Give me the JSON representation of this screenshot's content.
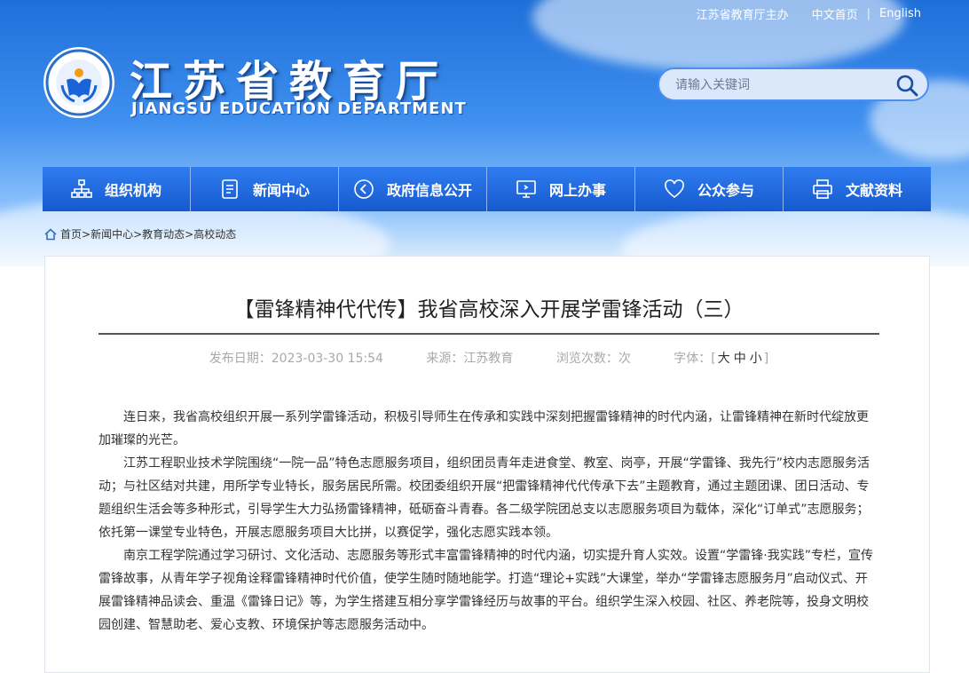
{
  "header": {
    "sponsor_link": "江苏省教育厅主办",
    "chinese_home": "中文首页",
    "separator": "|",
    "english": "English",
    "title_cn": "江苏省教育厅",
    "title_en": "JIANGSU EDUCATION DEPARTMENT",
    "search_placeholder": "请输入关键词"
  },
  "nav": {
    "items": [
      {
        "label": "组织机构",
        "icon": "org-chart-icon"
      },
      {
        "label": "新闻中心",
        "icon": "document-icon"
      },
      {
        "label": "政府信息公开",
        "icon": "open-info-icon"
      },
      {
        "label": "网上办事",
        "icon": "monitor-icon"
      },
      {
        "label": "公众参与",
        "icon": "heart-icon"
      },
      {
        "label": "文献资料",
        "icon": "printer-icon"
      }
    ]
  },
  "breadcrumb": {
    "items": [
      "首页",
      "新闻中心",
      "教育动态",
      "高校动态"
    ],
    "separator": ">"
  },
  "article": {
    "title": "【雷锋精神代代传】我省高校深入开展学雷锋活动（三）",
    "date": "发布日期：2023-03-30 15:54",
    "source": "来源：江苏教育",
    "views": "浏览次数：次",
    "fontsize_label": "字体：[",
    "fontsize_large": "大",
    "fontsize_medium": "中",
    "fontsize_small": "小",
    "fontsize_close": "]",
    "paragraphs": [
      "连日来，我省高校组织开展一系列学雷锋活动，积极引导师生在传承和实践中深刻把握雷锋精神的时代内涵，让雷锋精神在新时代绽放更加璀璨的光芒。",
      "江苏工程职业技术学院围绕“一院一品”特色志愿服务项目，组织团员青年走进食堂、教室、岗亭，开展“学雷锋、我先行”校内志愿服务活动；与社区结对共建，用所学专业特长，服务居民所需。校团委组织开展“把雷锋精神代代传承下去”主题教育，通过主题团课、团日活动、专题组织生活会等多种形式，引导学生大力弘扬雷锋精神，砥砺奋斗青春。各二级学院团总支以志愿服务项目为载体，深化“订单式”志愿服务；依托第一课堂专业特色，开展志愿服务项目大比拼，以赛促学，强化志愿实践本领。",
      "南京工程学院通过学习研讨、文化活动、志愿服务等形式丰富雷锋精神的时代内涵，切实提升育人实效。设置“学雷锋·我实践”专栏，宣传雷锋故事，从青年学子视角诠释雷锋精神时代价值，使学生随时随地能学。打造“理论+实践”大课堂，举办“学雷锋志愿服务月”启动仪式、开展雷锋精神品读会、重温《雷锋日记》等，为学生搭建互相分享学雷锋经历与故事的平台。组织学生深入校园、社区、养老院等，投身文明校园创建、智慧助老、爱心支教、环境保护等志愿服务活动中。"
    ]
  },
  "colors": {
    "nav_blue": "#1a63d8",
    "sky_top": "#1e6fd9",
    "text": "#333333",
    "meta_gray": "#a8a8a8"
  }
}
